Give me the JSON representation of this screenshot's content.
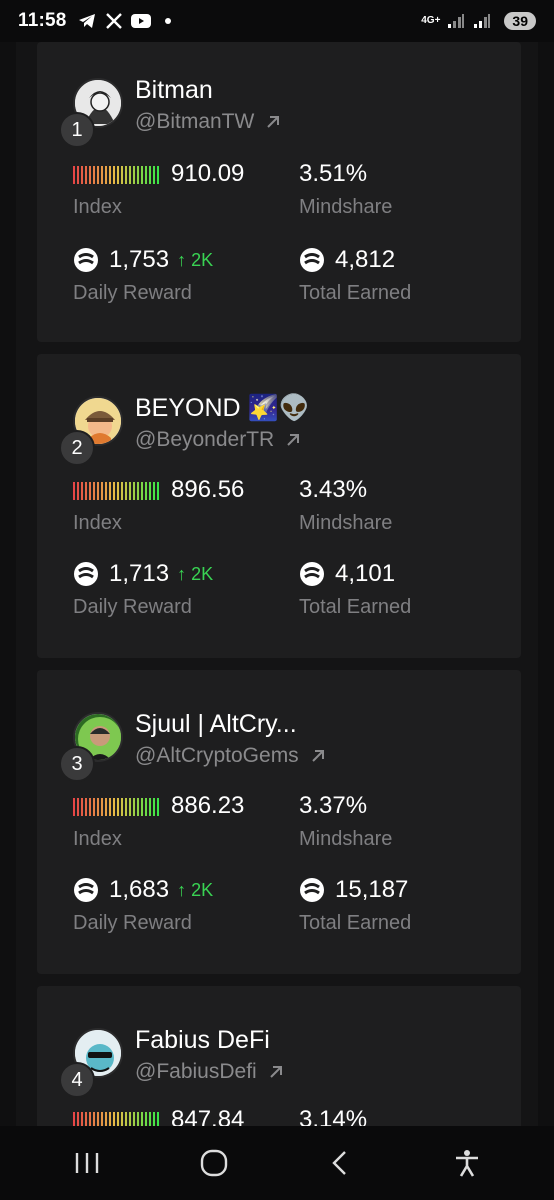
{
  "status": {
    "time": "11:58",
    "network": "4G+",
    "battery": "39"
  },
  "cards": [
    {
      "rank": "1",
      "name": "Bitman",
      "handle": "@BitmanTW",
      "index": "910.09",
      "index_label": "Index",
      "mindshare": "3.51%",
      "mindshare_label": "Mindshare",
      "daily_reward": "1,753",
      "delta": "2K",
      "daily_label": "Daily Reward",
      "total_earned": "4,812",
      "total_label": "Total Earned"
    },
    {
      "rank": "2",
      "name": "BEYOND 🌠👽",
      "handle": "@BeyonderTR",
      "index": "896.56",
      "index_label": "Index",
      "mindshare": "3.43%",
      "mindshare_label": "Mindshare",
      "daily_reward": "1,713",
      "delta": "2K",
      "daily_label": "Daily Reward",
      "total_earned": "4,101",
      "total_label": "Total Earned"
    },
    {
      "rank": "3",
      "name": "Sjuul | AltCry...",
      "handle": "@AltCryptoGems",
      "index": "886.23",
      "index_label": "Index",
      "mindshare": "3.37%",
      "mindshare_label": "Mindshare",
      "daily_reward": "1,683",
      "delta": "2K",
      "daily_label": "Daily Reward",
      "total_earned": "15,187",
      "total_label": "Total Earned"
    },
    {
      "rank": "4",
      "name": "Fabius DeFi",
      "handle": "@FabiusDefi",
      "index": "847.84",
      "mindshare": "3.14%"
    }
  ],
  "colors": {
    "card_bg": "#1e1e1f",
    "accent_green": "#39d353",
    "label_gray": "#7f7f82"
  },
  "icons": {
    "coin": "coin-icon",
    "arrow_out": "arrow-up-right-icon",
    "delta": "arrow-up-icon"
  }
}
